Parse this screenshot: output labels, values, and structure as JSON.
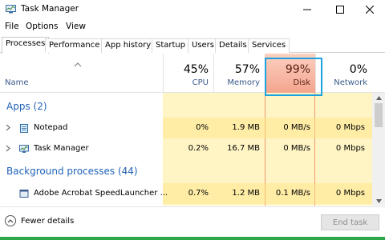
{
  "window": {
    "title": "Task Manager",
    "icon": "task-manager-icon"
  },
  "menu": [
    "File",
    "Options",
    "View"
  ],
  "tabs": [
    {
      "label": "Processes",
      "active": true
    },
    {
      "label": "Performance",
      "active": false
    },
    {
      "label": "App history",
      "active": false
    },
    {
      "label": "Startup",
      "active": false
    },
    {
      "label": "Users",
      "active": false
    },
    {
      "label": "Details",
      "active": false
    },
    {
      "label": "Services",
      "active": false
    }
  ],
  "columns": {
    "name": {
      "label": "Name"
    },
    "cpu": {
      "label": "CPU",
      "percent": "45%"
    },
    "memory": {
      "label": "Memory",
      "percent": "57%"
    },
    "disk": {
      "label": "Disk",
      "percent": "99%"
    },
    "network": {
      "label": "Network",
      "percent": "0%"
    }
  },
  "groups": {
    "apps": "Apps (2)",
    "background": "Background processes (44)"
  },
  "rows": [
    {
      "name": "Notepad",
      "icon": "notepad-icon",
      "cpu": "0%",
      "memory": "1.9 MB",
      "disk": "0 MB/s",
      "network": "0 Mbps"
    },
    {
      "name": "Task Manager",
      "icon": "task-manager-icon",
      "cpu": "0.2%",
      "memory": "16.7 MB",
      "disk": "0 MB/s",
      "network": "0 Mbps"
    },
    {
      "name": "Adobe Acrobat SpeedLauncher ...",
      "icon": "acrobat-icon",
      "cpu": "0.7%",
      "memory": "1.2 MB",
      "disk": "0.1 MB/s",
      "network": "0 Mbps"
    }
  ],
  "footer": {
    "fewer_details": "Fewer details",
    "end_task": "End task"
  },
  "colors": {
    "disk_highlight": "#1ca3e0",
    "disk_header": "#f4a58e",
    "cell_fill": "#fff4c4",
    "accent_green": "#2ca84a"
  }
}
